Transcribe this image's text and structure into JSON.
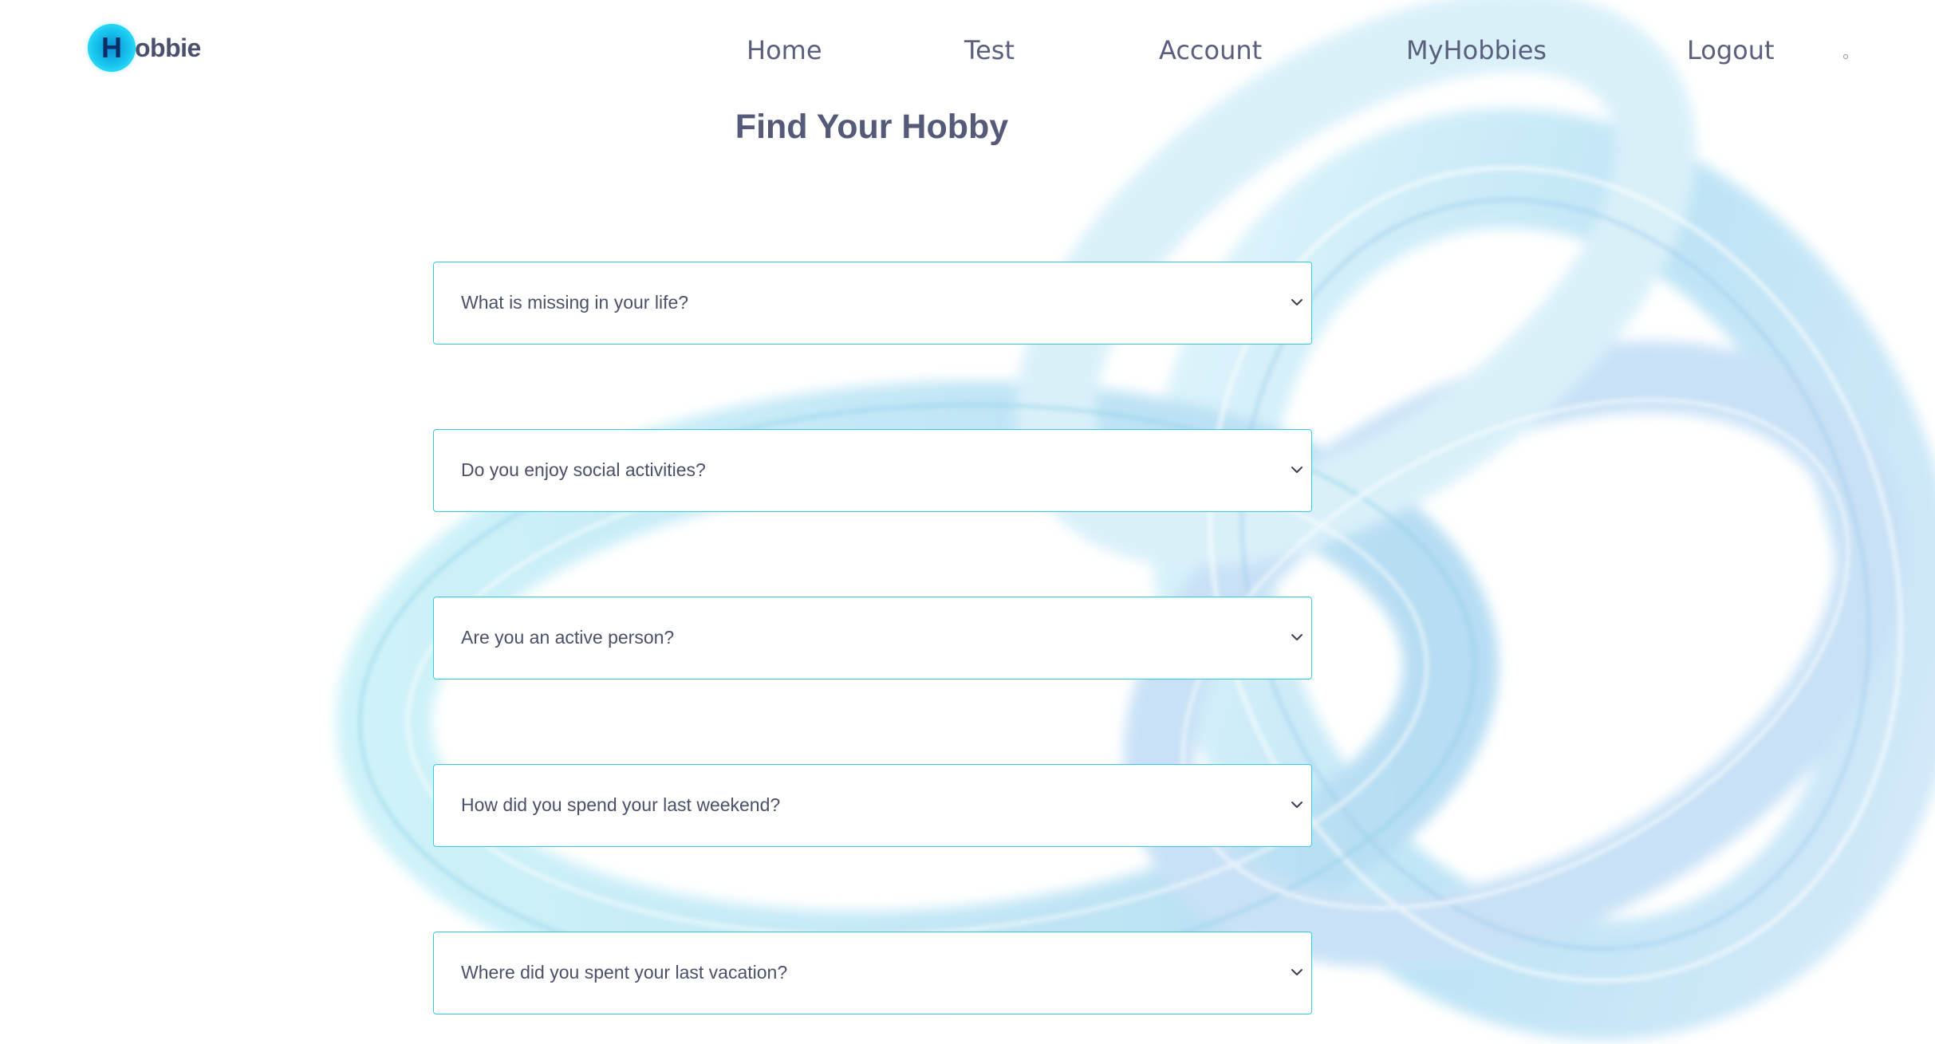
{
  "header": {
    "logo_letter": "H",
    "logo_text": "obbie",
    "nav": [
      {
        "label": "Home"
      },
      {
        "label": "Test"
      },
      {
        "label": "Account"
      },
      {
        "label": "MyHobbies"
      },
      {
        "label": "Logout"
      }
    ]
  },
  "main": {
    "title": "Find Your Hobby",
    "questions": [
      {
        "label": "What is missing in your life?"
      },
      {
        "label": "Do you enjoy social activities?"
      },
      {
        "label": "Are you an active person?"
      },
      {
        "label": "How did you spend your last weekend?"
      },
      {
        "label": "Where did you spent your last vacation?"
      }
    ]
  },
  "colors": {
    "accent_border": "#33cde3",
    "text": "#4b5069",
    "logo_cyan": "#18c7ef"
  },
  "icons": {
    "select_chevron": "chevron-down-icon"
  }
}
